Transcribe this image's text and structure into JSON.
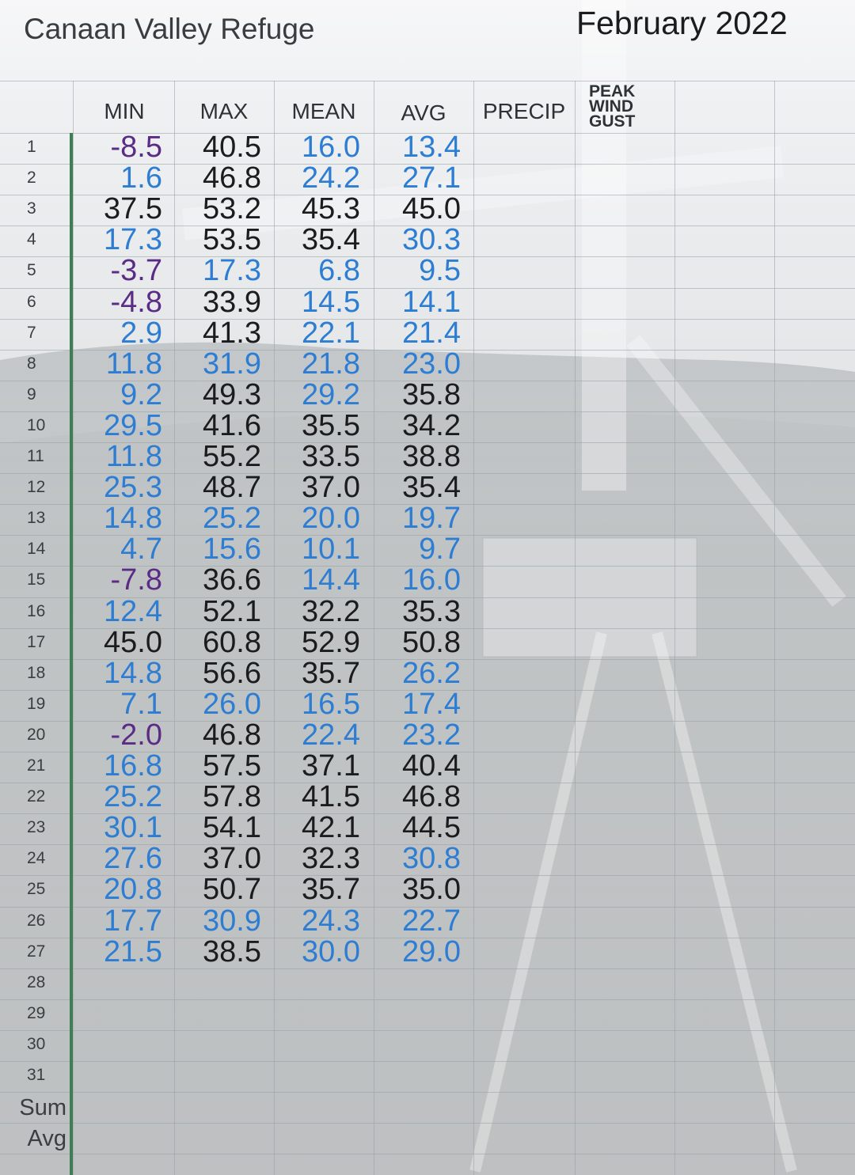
{
  "title": "Canaan Valley Refuge",
  "month": "February 2022",
  "columns": {
    "min": "MIN",
    "max": "MAX",
    "mean": "MEAN",
    "avg": "AVG",
    "precip": "PRECIP",
    "peak_wind_gust": [
      "PEAK",
      "WIND",
      "GUST"
    ]
  },
  "colors": {
    "black": "#1b1c1e",
    "blue": "#2d7dd2",
    "purple": "#5b2c86",
    "frozen_border": "#3f7d55"
  },
  "rows": [
    {
      "n": "1",
      "min": "-8.5",
      "minc": "purple",
      "max": "40.5",
      "maxc": "black",
      "mean": "16.0",
      "meanc": "blue",
      "avg": "13.4",
      "avgc": "blue"
    },
    {
      "n": "2",
      "min": "1.6",
      "minc": "blue",
      "max": "46.8",
      "maxc": "black",
      "mean": "24.2",
      "meanc": "blue",
      "avg": "27.1",
      "avgc": "blue"
    },
    {
      "n": "3",
      "min": "37.5",
      "minc": "black",
      "max": "53.2",
      "maxc": "black",
      "mean": "45.3",
      "meanc": "black",
      "avg": "45.0",
      "avgc": "black"
    },
    {
      "n": "4",
      "min": "17.3",
      "minc": "blue",
      "max": "53.5",
      "maxc": "black",
      "mean": "35.4",
      "meanc": "black",
      "avg": "30.3",
      "avgc": "blue"
    },
    {
      "n": "5",
      "min": "-3.7",
      "minc": "purple",
      "max": "17.3",
      "maxc": "blue",
      "mean": "6.8",
      "meanc": "blue",
      "avg": "9.5",
      "avgc": "blue"
    },
    {
      "n": "6",
      "min": "-4.8",
      "minc": "purple",
      "max": "33.9",
      "maxc": "black",
      "mean": "14.5",
      "meanc": "blue",
      "avg": "14.1",
      "avgc": "blue"
    },
    {
      "n": "7",
      "min": "2.9",
      "minc": "blue",
      "max": "41.3",
      "maxc": "black",
      "mean": "22.1",
      "meanc": "blue",
      "avg": "21.4",
      "avgc": "blue"
    },
    {
      "n": "8",
      "min": "11.8",
      "minc": "blue",
      "max": "31.9",
      "maxc": "blue",
      "mean": "21.8",
      "meanc": "blue",
      "avg": "23.0",
      "avgc": "blue"
    },
    {
      "n": "9",
      "min": "9.2",
      "minc": "blue",
      "max": "49.3",
      "maxc": "black",
      "mean": "29.2",
      "meanc": "blue",
      "avg": "35.8",
      "avgc": "black"
    },
    {
      "n": "10",
      "min": "29.5",
      "minc": "blue",
      "max": "41.6",
      "maxc": "black",
      "mean": "35.5",
      "meanc": "black",
      "avg": "34.2",
      "avgc": "black"
    },
    {
      "n": "11",
      "min": "11.8",
      "minc": "blue",
      "max": "55.2",
      "maxc": "black",
      "mean": "33.5",
      "meanc": "black",
      "avg": "38.8",
      "avgc": "black"
    },
    {
      "n": "12",
      "min": "25.3",
      "minc": "blue",
      "max": "48.7",
      "maxc": "black",
      "mean": "37.0",
      "meanc": "black",
      "avg": "35.4",
      "avgc": "black"
    },
    {
      "n": "13",
      "min": "14.8",
      "minc": "blue",
      "max": "25.2",
      "maxc": "blue",
      "mean": "20.0",
      "meanc": "blue",
      "avg": "19.7",
      "avgc": "blue"
    },
    {
      "n": "14",
      "min": "4.7",
      "minc": "blue",
      "max": "15.6",
      "maxc": "blue",
      "mean": "10.1",
      "meanc": "blue",
      "avg": "9.7",
      "avgc": "blue"
    },
    {
      "n": "15",
      "min": "-7.8",
      "minc": "purple",
      "max": "36.6",
      "maxc": "black",
      "mean": "14.4",
      "meanc": "blue",
      "avg": "16.0",
      "avgc": "blue"
    },
    {
      "n": "16",
      "min": "12.4",
      "minc": "blue",
      "max": "52.1",
      "maxc": "black",
      "mean": "32.2",
      "meanc": "black",
      "avg": "35.3",
      "avgc": "black"
    },
    {
      "n": "17",
      "min": "45.0",
      "minc": "black",
      "max": "60.8",
      "maxc": "black",
      "mean": "52.9",
      "meanc": "black",
      "avg": "50.8",
      "avgc": "black"
    },
    {
      "n": "18",
      "min": "14.8",
      "minc": "blue",
      "max": "56.6",
      "maxc": "black",
      "mean": "35.7",
      "meanc": "black",
      "avg": "26.2",
      "avgc": "blue"
    },
    {
      "n": "19",
      "min": "7.1",
      "minc": "blue",
      "max": "26.0",
      "maxc": "blue",
      "mean": "16.5",
      "meanc": "blue",
      "avg": "17.4",
      "avgc": "blue"
    },
    {
      "n": "20",
      "min": "-2.0",
      "minc": "purple",
      "max": "46.8",
      "maxc": "black",
      "mean": "22.4",
      "meanc": "blue",
      "avg": "23.2",
      "avgc": "blue"
    },
    {
      "n": "21",
      "min": "16.8",
      "minc": "blue",
      "max": "57.5",
      "maxc": "black",
      "mean": "37.1",
      "meanc": "black",
      "avg": "40.4",
      "avgc": "black"
    },
    {
      "n": "22",
      "min": "25.2",
      "minc": "blue",
      "max": "57.8",
      "maxc": "black",
      "mean": "41.5",
      "meanc": "black",
      "avg": "46.8",
      "avgc": "black"
    },
    {
      "n": "23",
      "min": "30.1",
      "minc": "blue",
      "max": "54.1",
      "maxc": "black",
      "mean": "42.1",
      "meanc": "black",
      "avg": "44.5",
      "avgc": "black"
    },
    {
      "n": "24",
      "min": "27.6",
      "minc": "blue",
      "max": "37.0",
      "maxc": "black",
      "mean": "32.3",
      "meanc": "black",
      "avg": "30.8",
      "avgc": "blue"
    },
    {
      "n": "25",
      "min": "20.8",
      "minc": "blue",
      "max": "50.7",
      "maxc": "black",
      "mean": "35.7",
      "meanc": "black",
      "avg": "35.0",
      "avgc": "black"
    },
    {
      "n": "26",
      "min": "17.7",
      "minc": "blue",
      "max": "30.9",
      "maxc": "blue",
      "mean": "24.3",
      "meanc": "blue",
      "avg": "22.7",
      "avgc": "blue"
    },
    {
      "n": "27",
      "min": "21.5",
      "minc": "blue",
      "max": "38.5",
      "maxc": "black",
      "mean": "30.0",
      "meanc": "blue",
      "avg": "29.0",
      "avgc": "blue"
    },
    {
      "n": "28"
    },
    {
      "n": "29"
    },
    {
      "n": "30"
    },
    {
      "n": "31"
    }
  ],
  "footer_rows": [
    "Sum",
    "Avg"
  ]
}
